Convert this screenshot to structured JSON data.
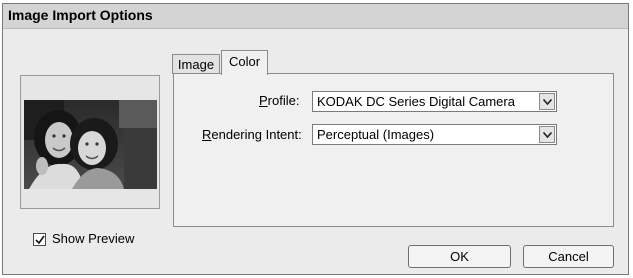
{
  "dialog": {
    "title": "Image Import Options"
  },
  "preview": {
    "show_preview_label": "Show Preview",
    "show_preview_checked": true
  },
  "tabs": [
    {
      "label": "Image",
      "active": false
    },
    {
      "label": "Color",
      "active": true
    }
  ],
  "color_tab": {
    "profile": {
      "mnemonic": "P",
      "label_rest": "rofile:",
      "value": "KODAK DC Series Digital Camera"
    },
    "rendering_intent": {
      "mnemonic": "R",
      "label_rest": "endering Intent:",
      "value": "Perceptual (Images)"
    }
  },
  "buttons": {
    "ok": "OK",
    "cancel": "Cancel"
  }
}
